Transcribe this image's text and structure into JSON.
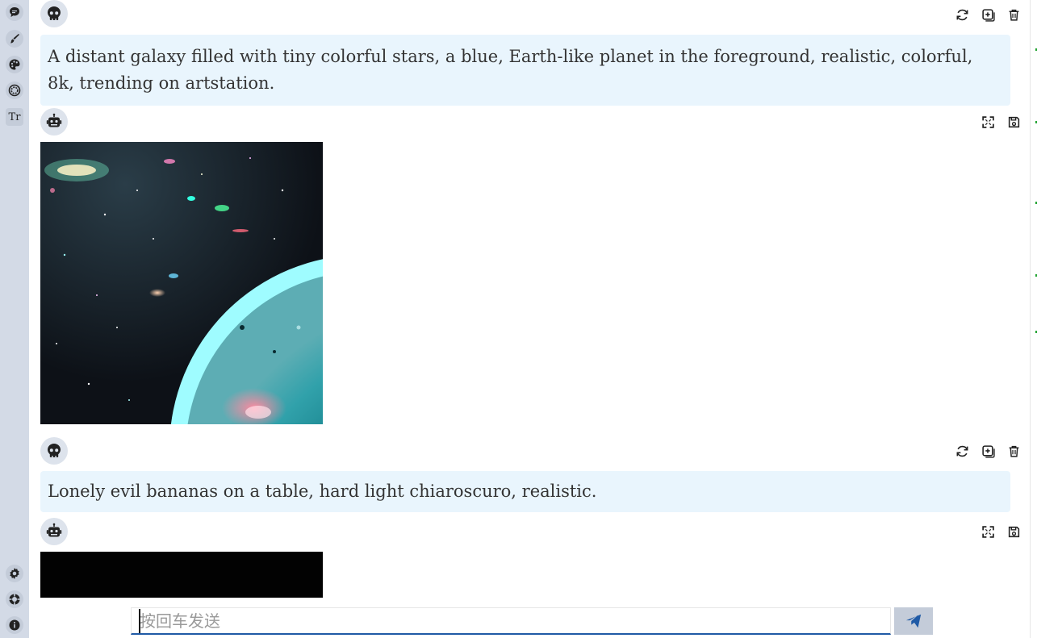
{
  "sidebar": {
    "top_icons": [
      "chat-icon",
      "brush-icon",
      "palette-icon",
      "lens-icon",
      "text-size-icon"
    ],
    "text_size_label": "Tr",
    "bottom_icons": [
      "gear-icon",
      "help-icon",
      "info-icon"
    ]
  },
  "messages": [
    {
      "role": "user",
      "avatar_icon": "skull-icon",
      "actions": [
        "refresh-icon",
        "add-icon",
        "trash-icon"
      ],
      "text": "A distant galaxy filled with tiny colorful stars, a blue, Earth-like planet in the foreground, realistic, colorful, 8k, trending on artstation."
    },
    {
      "role": "bot",
      "avatar_icon": "robot-icon",
      "actions": [
        "expand-icon",
        "save-icon"
      ],
      "image": "galaxy"
    },
    {
      "role": "user",
      "avatar_icon": "skull-icon",
      "actions": [
        "refresh-icon",
        "add-icon",
        "trash-icon"
      ],
      "text": "Lonely evil bananas on a table, hard light chiaroscuro, realistic."
    },
    {
      "role": "bot",
      "avatar_icon": "robot-icon",
      "actions": [
        "expand-icon",
        "save-icon"
      ],
      "image": "black"
    }
  ],
  "composer": {
    "placeholder": "按回车发送",
    "value": "",
    "send_icon": "send-icon"
  },
  "colors": {
    "sidebar_bg": "#d3dae6",
    "bubble_bg": "#e9f5fd",
    "input_underline": "#1f5aa6",
    "send_icon": "#1f5aa6"
  }
}
